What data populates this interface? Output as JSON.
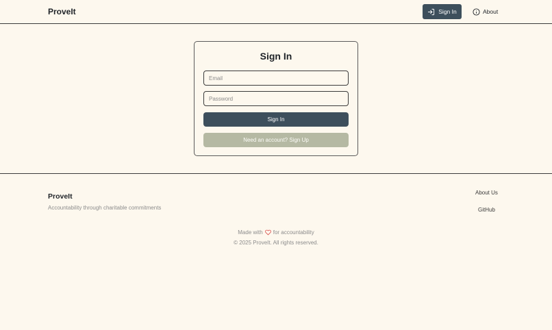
{
  "header": {
    "brand": "ProveIt",
    "signin_label": "Sign In",
    "about_label": "About",
    "icons": {
      "signin": "sign-in-icon",
      "about": "info-icon"
    }
  },
  "signin_card": {
    "title": "Sign In",
    "email_placeholder": "Email",
    "email_value": "",
    "password_placeholder": "Password",
    "password_value": "",
    "submit_label": "Sign In",
    "signup_label": "Need an account? Sign Up"
  },
  "footer": {
    "brand": "ProveIt",
    "tagline": "Accountability through charitable commitments",
    "links": [
      "About Us",
      "GitHub"
    ],
    "made_prefix": "Made with",
    "made_suffix": "for accountability",
    "copyright": "© 2025 ProveIt. All rights reserved.",
    "icons": {
      "heart": "heart-icon"
    }
  },
  "colors": {
    "background": "#fdf8ee",
    "primary": "#3d4f5c",
    "secondary": "#b5b9a3",
    "heart": "#d9534f"
  }
}
